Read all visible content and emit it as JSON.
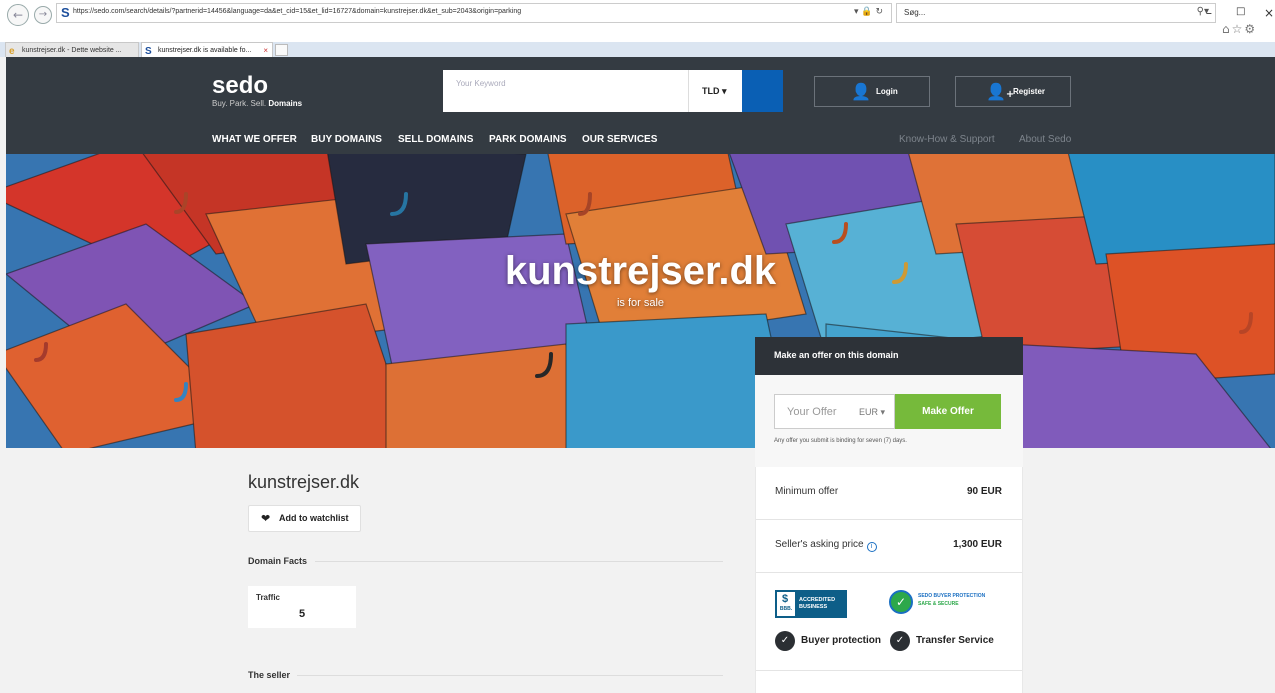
{
  "browser": {
    "url": "https://sedo.com/search/details/?partnerid=14456&language=da&et_cid=15&et_lid=16727&domain=kunstrejser.dk&et_sub=2043&origin=parking",
    "search_placeholder": "Søg...",
    "tabs": [
      {
        "label": "kunstrejser.dk - Dette website ..."
      },
      {
        "label": "kunstrejser.dk is available fo..."
      }
    ]
  },
  "header": {
    "logo": "sedo",
    "tagline_prefix": "Buy. Park. Sell.",
    "tagline_bold": "Domains",
    "keyword_placeholder": "Your Keyword",
    "tld_label": "TLD",
    "login_label": "Login",
    "register_label": "Register",
    "main_nav": [
      "WHAT WE OFFER",
      "BUY DOMAINS",
      "SELL DOMAINS",
      "PARK DOMAINS",
      "OUR SERVICES"
    ],
    "sub_nav": [
      "Know-How & Support",
      "About Sedo"
    ]
  },
  "hero": {
    "domain": "kunstrejser.dk",
    "subtitle": "is for sale"
  },
  "offer": {
    "title": "Make an offer on this domain",
    "input_placeholder": "Your Offer",
    "currency": "EUR",
    "button_label": "Make Offer",
    "note": "Any offer you submit is binding for seven (7) days."
  },
  "pricing": {
    "minimum_label": "Minimum offer",
    "minimum_value": "90 EUR",
    "asking_label": "Seller's asking price",
    "asking_value": "1,300 EUR"
  },
  "badges": {
    "bbb_seal": "BBB.",
    "bbb_line1": "ACCREDITED",
    "bbb_line2": "BUSINESS",
    "sedo_line1": "SEDO BUYER PROTECTION",
    "sedo_line2": "SAFE & SECURE",
    "feature1": "Buyer protection",
    "feature2": "Transfer Service"
  },
  "main": {
    "domain_title": "kunstrejser.dk",
    "watchlist_label": "Add to watchlist",
    "domain_facts_heading": "Domain Facts",
    "traffic_label": "Traffic",
    "traffic_value": "5",
    "seller_heading": "The seller"
  }
}
